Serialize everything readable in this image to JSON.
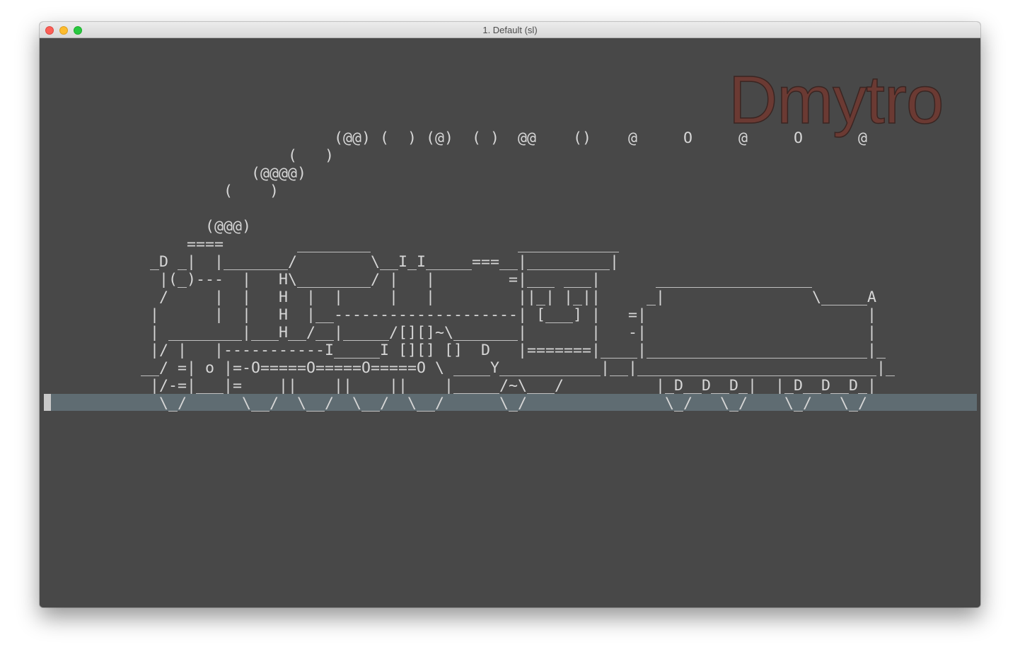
{
  "window": {
    "title": "1. Default (sl)"
  },
  "terminal": {
    "watermark": "Dmytro",
    "art_lines": [
      "                     (@@) (  ) (@)  ( )  @@    ()    @     O     @     O      @",
      "                (   )",
      "            (@@@@)",
      "         (    )",
      "",
      "       (@@@)",
      "     ====        ________                ___________",
      " _D _|  |_______/        \\__I_I_____===__|_________|",
      "  |(_)---  |   H\\________/ |   |        =|___ ___|      _________________",
      "  /     |  |   H  |  |     |   |         ||_| |_||     _|                \\_____A",
      " |      |  |   H  |__--------------------| [___] |   =|                        |",
      " | ________|___H__/__|_____/[][]~\\_______|       |   -|                        |",
      " |/ |   |-----------I_____I [][] []  D   |=======|____|________________________|_",
      "__/ =| o |=-O=====O=====O=====O \\ ____Y___________|__|__________________________|_",
      " |/-=|___|=    ||    ||    ||    |_____/~\\___/          |_D__D__D_|  |_D__D__D_|",
      "  \\_/      \\__/  \\__/  \\__/  \\__/      \\_/               \\_/   \\_/    \\_/   \\_/"
    ]
  },
  "colors": {
    "terminal_bg": "#484848",
    "text": "#d6d6d6",
    "highlight_row": "#5f6c72",
    "watermark": "#6b3a33"
  }
}
